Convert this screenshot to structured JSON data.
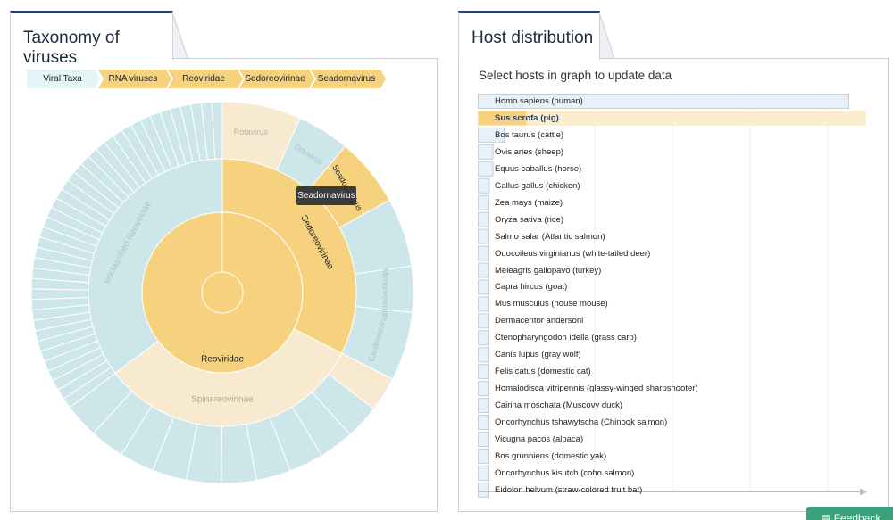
{
  "taxonomy_panel": {
    "title": "Taxonomy of viruses",
    "breadcrumbs": [
      "Viral Taxa",
      "RNA viruses",
      "Reoviridae",
      "Sedoreovirinae",
      "Seadornavirus"
    ],
    "sunburst": {
      "center": "Reoviridae",
      "subfamilies": [
        "Sedoreovirinae",
        "Spinareovirinae",
        "unclassified Reoviridae"
      ],
      "genera": [
        "Rotavirus",
        "Orbivirus",
        "Seadornavirus",
        "Mimoreovirus",
        "Cardoreovirus"
      ],
      "tooltip": "Seadornavirus"
    },
    "colors": {
      "selected": "#f6d27f",
      "dimmed": "#f8ead0",
      "other": "#cce6e9",
      "crumb_root": "#e5f4f7"
    }
  },
  "host_panel": {
    "title": "Host distribution",
    "subtitle": "Select hosts in graph to update data",
    "selected_host": "Sus scrofa (pig)",
    "hosts": [
      {
        "name": "Homo sapiens (human)",
        "value": 100
      },
      {
        "name": "Sus scrofa (pig)",
        "value": 13
      },
      {
        "name": "Bos taurus (cattle)",
        "value": 7
      },
      {
        "name": "Ovis aries (sheep)",
        "value": 4
      },
      {
        "name": "Equus caballus (horse)",
        "value": 4
      },
      {
        "name": "Gallus gallus (chicken)",
        "value": 3
      },
      {
        "name": "Zea mays (maize)",
        "value": 1
      },
      {
        "name": "Oryza sativa (rice)",
        "value": 1
      },
      {
        "name": "Salmo salar (Atlantic salmon)",
        "value": 1
      },
      {
        "name": "Odocoileus virginianus (white-tailed deer)",
        "value": 1
      },
      {
        "name": "Meleagris gallopavo (turkey)",
        "value": 1
      },
      {
        "name": "Capra hircus (goat)",
        "value": 1
      },
      {
        "name": "Mus musculus (house mouse)",
        "value": 1
      },
      {
        "name": "Dermacentor andersoni",
        "value": 1
      },
      {
        "name": "Ctenopharyngodon idella (grass carp)",
        "value": 1
      },
      {
        "name": "Canis lupus (gray wolf)",
        "value": 1
      },
      {
        "name": "Felis catus (domestic cat)",
        "value": 1
      },
      {
        "name": "Homalodisca vitripennis (glassy-winged sharpshooter)",
        "value": 1
      },
      {
        "name": "Cairina moschata (Muscovy duck)",
        "value": 1
      },
      {
        "name": "Oncorhynchus tshawytscha (Chinook salmon)",
        "value": 1
      },
      {
        "name": "Vicugna pacos (alpaca)",
        "value": 1
      },
      {
        "name": "Bos grunniens (domestic yak)",
        "value": 1
      },
      {
        "name": "Oncorhynchus kisutch (coho salmon)",
        "value": 1
      },
      {
        "name": "Eidolon helvum (straw-colored fruit bat)",
        "value": 1
      }
    ],
    "colors": {
      "bar": "#e8f0f8",
      "selected_bar": "#f6d27f",
      "selected_row": "#fbeed0"
    }
  },
  "feedback_button": {
    "label": "Feedback",
    "icon": "feedback-icon"
  }
}
